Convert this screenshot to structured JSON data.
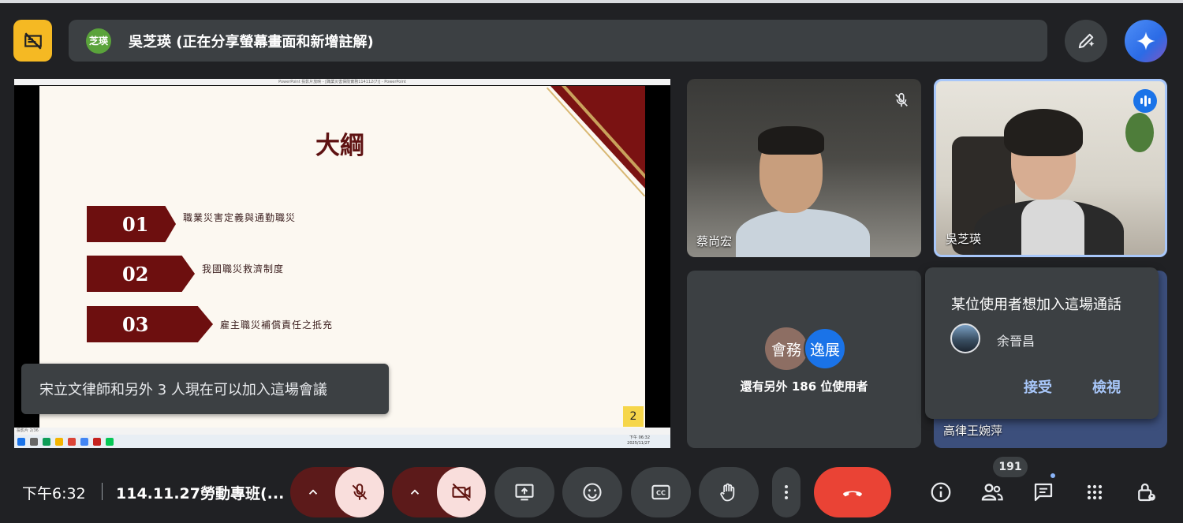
{
  "presenter": {
    "avatar_initials": "芝瑛",
    "status_text": "吳芝瑛 (正在分享螢幕畫面和新增註解)"
  },
  "shared_screen": {
    "window_title": "PowerPoint 投影片放映 - [職業災害保險實務114112(7)] - PowerPoint",
    "slide_title": "大綱",
    "items": [
      {
        "number": "01",
        "text": "職業災害定義與通勤職災"
      },
      {
        "number": "02",
        "text": "我國職災救濟制度"
      },
      {
        "number": "03",
        "text": "雇主職災補償責任之抵充"
      }
    ],
    "page_number": "2",
    "status_bar": "投影片 2/36",
    "clock_time": "下午 06:32",
    "clock_date": "2025/11/27"
  },
  "toast": {
    "text": "宋立文律師和另外 3 人現在可以加入這場會議"
  },
  "tiles": [
    {
      "name": "蔡尚宏"
    },
    {
      "name": "吳芝瑛"
    }
  ],
  "others_tile": {
    "avatars": [
      "會務",
      "逸展"
    ],
    "text": "還有另外 186 位使用者"
  },
  "tile4_name": "高律王婉萍",
  "join_request": {
    "title": "某位使用者想加入這場通話",
    "requester": "余晉昌",
    "accept_label": "接受",
    "view_label": "檢視"
  },
  "bottom_bar": {
    "time": "下午6:32",
    "meeting_name": "114.11.27勞動專班(...",
    "participants_count": "191"
  },
  "colors": {
    "accent_blue": "#a8c7fa",
    "hangup_red": "#ea4335",
    "no_present_yellow": "#f5b923"
  }
}
